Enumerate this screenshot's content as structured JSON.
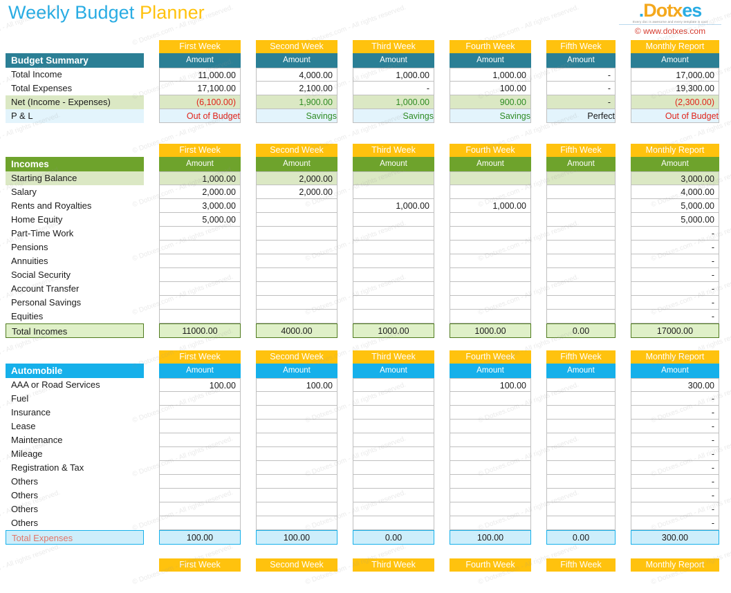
{
  "header": {
    "title_part1": "Weekly Budget",
    "title_part2": "Planner",
    "logo_dot": ".",
    "logo_d": "D",
    "logo_o": "o",
    "logo_t": "t",
    "logo_x": "x",
    "logo_e": "e",
    "logo_s": "s",
    "logo_tagline": "Every doc is awesome and every template is cool",
    "logo_url": "© www.dotxes.com",
    "accent_blue": "#29ace3",
    "accent_yellow": "#ffc20e",
    "accent_teal": "#2b7f95",
    "accent_green": "#6ea32c",
    "accent_cyan": "#16b0ea",
    "accent_red": "#e0231a"
  },
  "watermark_text": "© Dotxes.com - All rights reserved.",
  "columns": [
    {
      "week": "First Week",
      "sub": "Amount"
    },
    {
      "week": "Second Week",
      "sub": "Amount"
    },
    {
      "week": "Third Week",
      "sub": "Amount"
    },
    {
      "week": "Fourth Week",
      "sub": "Amount"
    },
    {
      "week": "Fifth Week",
      "sub": "Amount"
    },
    {
      "week": "Monthly Report",
      "sub": "Amount"
    }
  ],
  "summary": {
    "heading": "Budget Summary",
    "rows": [
      {
        "label": "Total Income",
        "values": [
          "11,000.00",
          "4,000.00",
          "1,000.00",
          "1,000.00",
          "-",
          "17,000.00"
        ],
        "style": "plain"
      },
      {
        "label": "Total Expenses",
        "values": [
          "17,100.00",
          "2,100.00",
          "-",
          "100.00",
          "-",
          "19,300.00"
        ],
        "style": "plain"
      },
      {
        "label": "Net (Income - Expenses)",
        "values": [
          "(6,100.00)",
          "1,900.00",
          "1,000.00",
          "900.00",
          "-",
          "(2,300.00)"
        ],
        "style": "greenbg",
        "value_colors": [
          "neg",
          "pos",
          "pos",
          "pos",
          "",
          "neg"
        ]
      },
      {
        "label": "P & L",
        "values": [
          "Out of Budget",
          "Savings",
          "Savings",
          "Savings",
          "Perfect",
          "Out of Budget"
        ],
        "style": "bluebg",
        "value_colors": [
          "neg",
          "pos",
          "pos",
          "pos",
          "",
          "neg"
        ]
      }
    ]
  },
  "incomes": {
    "heading": "Incomes",
    "total_label": "Total Incomes",
    "rows": [
      {
        "label": "Starting Balance",
        "values": [
          "1,000.00",
          "2,000.00",
          "",
          "",
          "",
          "3,000.00"
        ],
        "style": "greenbg"
      },
      {
        "label": "Salary",
        "values": [
          "2,000.00",
          "2,000.00",
          "",
          "",
          "",
          "4,000.00"
        ],
        "style": "plain"
      },
      {
        "label": "Rents and Royalties",
        "values": [
          "3,000.00",
          "",
          "1,000.00",
          "1,000.00",
          "",
          "5,000.00"
        ],
        "style": "plain"
      },
      {
        "label": "Home Equity",
        "values": [
          "5,000.00",
          "",
          "",
          "",
          "",
          "5,000.00"
        ],
        "style": "plain"
      },
      {
        "label": "Part-Time Work",
        "values": [
          "",
          "",
          "",
          "",
          "",
          "-"
        ],
        "style": "plain"
      },
      {
        "label": "Pensions",
        "values": [
          "",
          "",
          "",
          "",
          "",
          "-"
        ],
        "style": "plain"
      },
      {
        "label": "Annuities",
        "values": [
          "",
          "",
          "",
          "",
          "",
          "-"
        ],
        "style": "plain"
      },
      {
        "label": "Social Security",
        "values": [
          "",
          "",
          "",
          "",
          "",
          "-"
        ],
        "style": "plain"
      },
      {
        "label": "Account Transfer",
        "values": [
          "",
          "",
          "",
          "",
          "",
          "-"
        ],
        "style": "plain"
      },
      {
        "label": "Personal Savings",
        "values": [
          "",
          "",
          "",
          "",
          "",
          "-"
        ],
        "style": "plain"
      },
      {
        "label": "Equities",
        "values": [
          "",
          "",
          "",
          "",
          "",
          "-"
        ],
        "style": "plain"
      }
    ],
    "totals": [
      "11000.00",
      "4000.00",
      "1000.00",
      "1000.00",
      "0.00",
      "17000.00"
    ]
  },
  "automobile": {
    "heading": "Automobile",
    "total_label": "Total  Expenses",
    "rows": [
      {
        "label": "AAA or Road Services",
        "values": [
          "100.00",
          "100.00",
          "",
          "100.00",
          "",
          "300.00"
        ]
      },
      {
        "label": "Fuel",
        "values": [
          "",
          "",
          "",
          "",
          "",
          "-"
        ]
      },
      {
        "label": "Insurance",
        "values": [
          "",
          "",
          "",
          "",
          "",
          "-"
        ]
      },
      {
        "label": "Lease",
        "values": [
          "",
          "",
          "",
          "",
          "",
          "-"
        ]
      },
      {
        "label": "Maintenance",
        "values": [
          "",
          "",
          "",
          "",
          "",
          "-"
        ]
      },
      {
        "label": "Mileage",
        "values": [
          "",
          "",
          "",
          "",
          "",
          "-"
        ]
      },
      {
        "label": "Registration & Tax",
        "values": [
          "",
          "",
          "",
          "",
          "",
          "-"
        ]
      },
      {
        "label": "Others",
        "values": [
          "",
          "",
          "",
          "",
          "",
          "-"
        ]
      },
      {
        "label": "Others",
        "values": [
          "",
          "",
          "",
          "",
          "",
          "-"
        ]
      },
      {
        "label": "Others",
        "values": [
          "",
          "",
          "",
          "",
          "",
          "-"
        ]
      },
      {
        "label": "Others",
        "values": [
          "",
          "",
          "",
          "",
          "",
          "-"
        ]
      }
    ],
    "totals": [
      "100.00",
      "100.00",
      "0.00",
      "100.00",
      "0.00",
      "300.00"
    ]
  },
  "next_section": {
    "columns": [
      "First Week",
      "Second Week",
      "Third Week",
      "Fourth Week",
      "Fifth Week",
      "Monthly Report"
    ]
  }
}
